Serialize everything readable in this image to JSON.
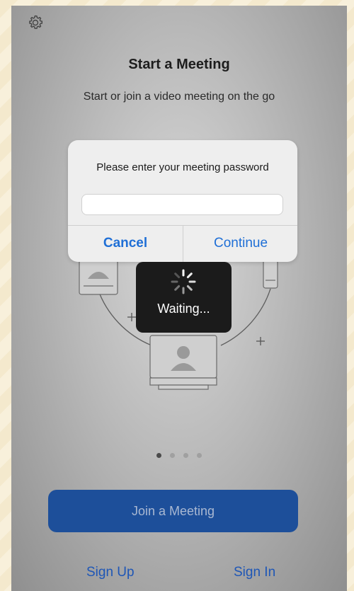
{
  "header": {
    "title": "Start a Meeting",
    "subtitle": "Start or join a video meeting on the go",
    "settings_icon": "gear-icon"
  },
  "dialog": {
    "prompt": "Please enter your meeting password",
    "password_value": "",
    "cancel_label": "Cancel",
    "continue_label": "Continue"
  },
  "loading": {
    "label": "Waiting...",
    "icon": "spinner-icon"
  },
  "carousel": {
    "pages": 4,
    "active_index": 0
  },
  "actions": {
    "join_label": "Join a Meeting",
    "signup_label": "Sign Up",
    "signin_label": "Sign In"
  },
  "colors": {
    "accent": "#1f6fd6",
    "join_button": "#1d4f9a"
  }
}
